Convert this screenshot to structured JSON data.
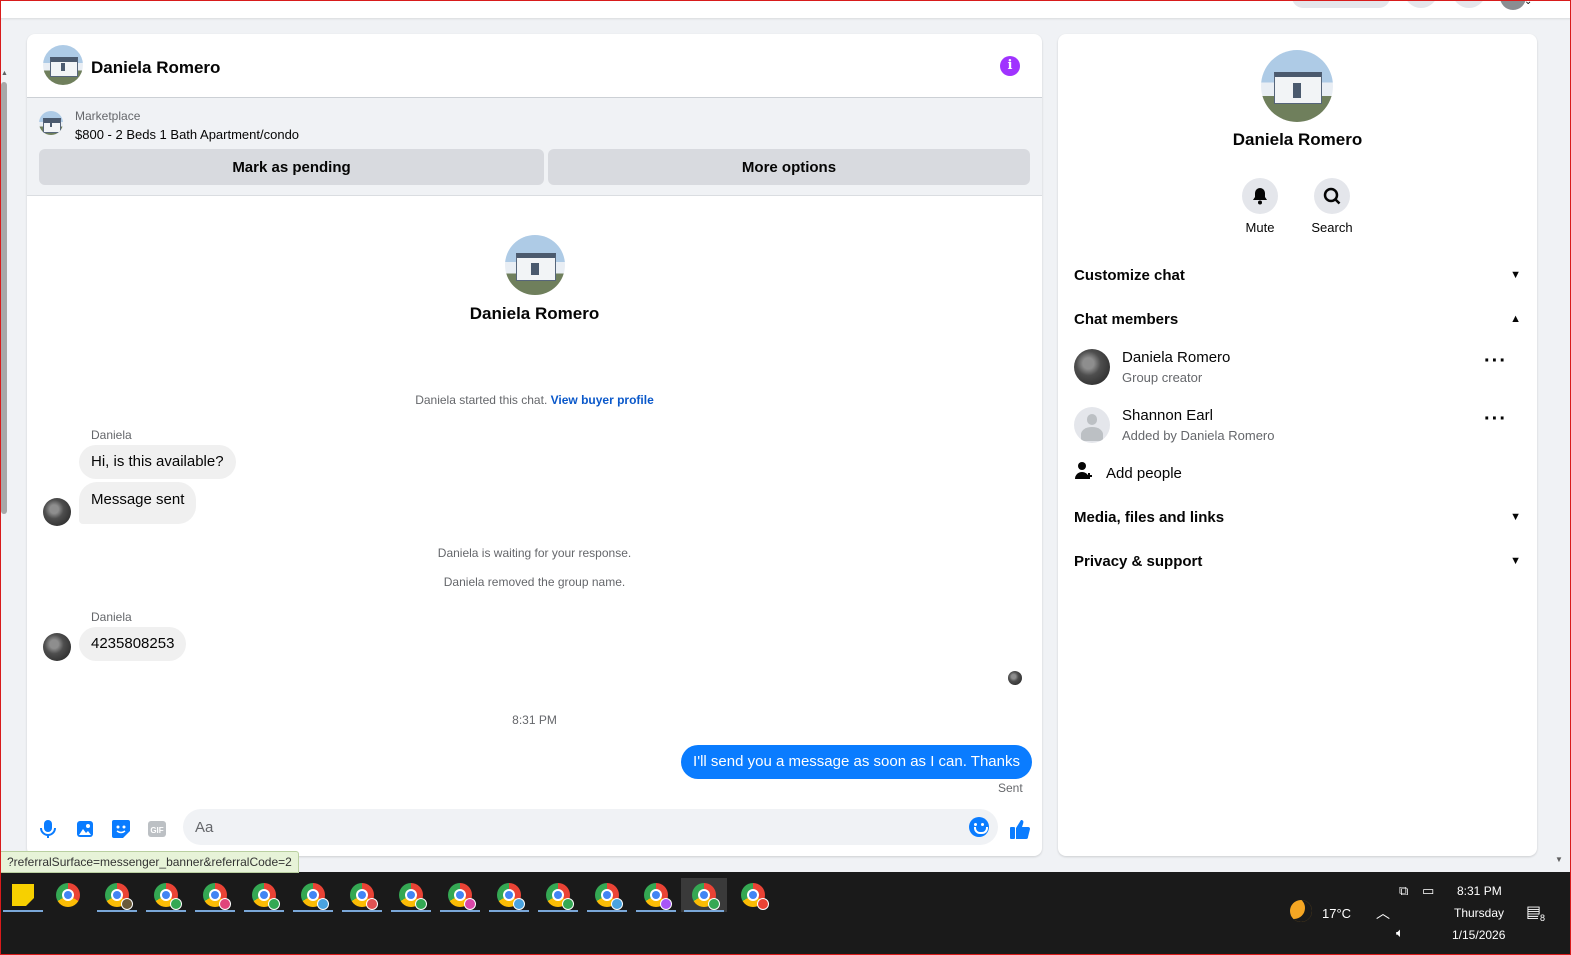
{
  "header": {
    "contact_name": "Daniela Romero"
  },
  "marketplace": {
    "label": "Marketplace",
    "listing": "$800 - 2 Beds 1 Bath Apartment/condo",
    "mark_pending_label": "Mark as pending",
    "more_options_label": "More options"
  },
  "conversation": {
    "profile_name": "Daniela Romero",
    "started_text": "Daniela started this chat.",
    "buyer_profile_link": "View buyer profile",
    "group1_sender": "Daniela",
    "msg1": "Hi, is this available?",
    "msg2": "Message sent",
    "waiting_text": "Daniela is waiting for your response.",
    "removed_text": "Daniela removed the group name.",
    "group2_sender": "Daniela",
    "msg3": "4235808253",
    "timestamp": "8:31 PM",
    "outgoing": "I'll send you a message as soon as I can. Thanks",
    "sent_status": "Sent"
  },
  "composer": {
    "placeholder": "Aa"
  },
  "status_url": "?referralSurface=messenger_banner&referralCode=2",
  "sidebar": {
    "name": "Daniela Romero",
    "mute_label": "Mute",
    "search_label": "Search",
    "customize_label": "Customize chat",
    "members_label": "Chat members",
    "members": [
      {
        "name": "Daniela Romero",
        "role": "Group creator"
      },
      {
        "name": "Shannon Earl",
        "role": "Added by Daniela Romero"
      }
    ],
    "add_people_label": "Add people",
    "media_label": "Media, files and links",
    "privacy_label": "Privacy & support"
  },
  "taskbar": {
    "temperature": "17°C",
    "time": "8:31 PM",
    "day": "Thursday",
    "date": "1/15/2026",
    "notification_count": "8",
    "chrome_badge_colors": [
      "",
      "#6b5b3a",
      "#34a853",
      "#e0457b",
      "#34a853",
      "#4aa3df",
      "#e05252",
      "#34a853",
      "#d946a8",
      "#4aa3df",
      "#34a853",
      "#4aa3df",
      "#a855f7",
      "#34a853",
      "#ea4335"
    ]
  },
  "colors": {
    "accent": "#0a7cff",
    "info": "#a033ff"
  }
}
